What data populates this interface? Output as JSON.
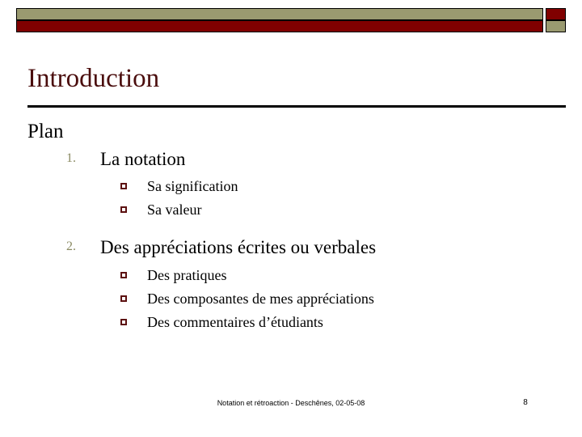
{
  "slide": {
    "title": "Introduction",
    "page_number": "8",
    "footer": "Notation et rétroaction - Deschênes, 02-05-08",
    "colors": {
      "title": "#4a0d0d",
      "deco_olive": "#9a9a70",
      "deco_red": "#800000",
      "number_marker": "#8a8a62",
      "square_marker": "#5c1010",
      "body_text": "#000000",
      "rule": "#000000"
    }
  },
  "decoration": {
    "top_bar_name": "olive-bar",
    "top_square_name": "red-square",
    "bottom_bar_name": "red-bar",
    "bottom_square_name": "olive-square"
  },
  "body": {
    "heading": "Plan",
    "items": [
      {
        "marker": "1.",
        "label": "La notation",
        "subitems": [
          {
            "marker": "o",
            "label": "Sa signification"
          },
          {
            "marker": "o",
            "label": "Sa valeur"
          }
        ]
      },
      {
        "marker": "2.",
        "label": "Des appréciations écrites ou verbales",
        "subitems": [
          {
            "marker": "o",
            "label": "Des pratiques"
          },
          {
            "marker": "o",
            "label": "Des composantes de mes appréciations"
          },
          {
            "marker": "o",
            "label": "Des commentaires d’étudiants"
          }
        ]
      }
    ]
  }
}
